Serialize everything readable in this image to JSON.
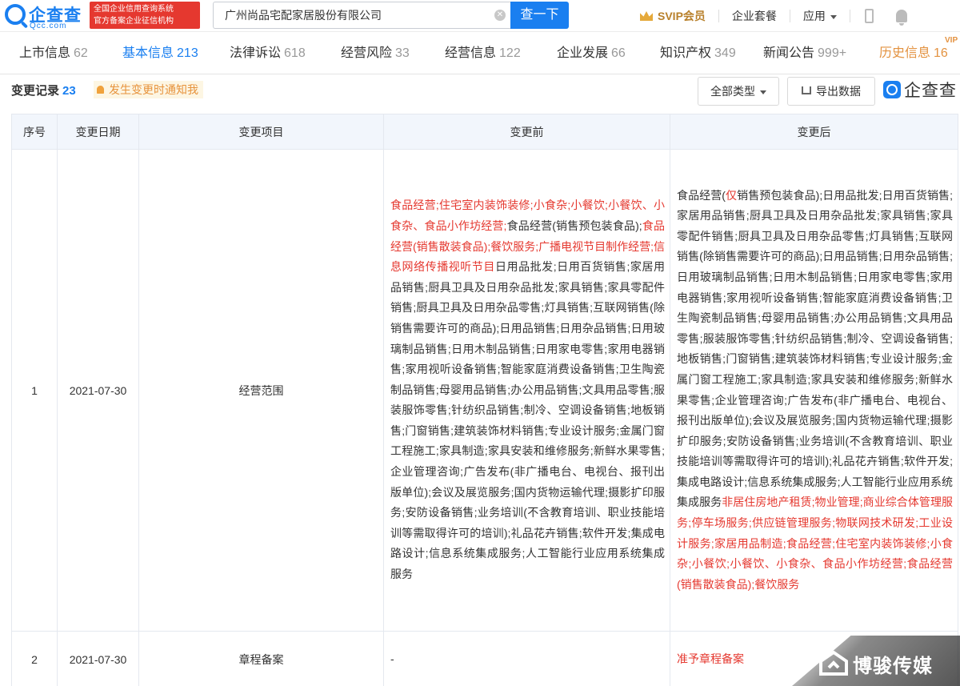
{
  "header": {
    "logo_text": "企查查",
    "logo_sub": "Qcc.com",
    "badge_line1": "全国企业信用查询系统",
    "badge_line2": "官方备案企业征信机构",
    "search_value": "广州尚品宅配家居股份有限公司",
    "search_button": "查一下",
    "svip": "SVIP会员",
    "enterprise_pkg": "企业套餐",
    "apps": "应用"
  },
  "tabs": [
    {
      "label": "上市信息",
      "count": "62"
    },
    {
      "label": "基本信息",
      "count": "213"
    },
    {
      "label": "法律诉讼",
      "count": "618"
    },
    {
      "label": "经营风险",
      "count": "33"
    },
    {
      "label": "经营信息",
      "count": "122"
    },
    {
      "label": "企业发展",
      "count": "66"
    },
    {
      "label": "知识产权",
      "count": "349"
    },
    {
      "label": "新闻公告",
      "count": "999+"
    },
    {
      "label": "历史信息",
      "count": "16"
    }
  ],
  "vip_tag": "VIP",
  "section": {
    "title": "变更记录",
    "count": "23",
    "notify": "发生变更时通知我",
    "type_filter": "全部类型",
    "export": "导出数据",
    "brand": "企查查"
  },
  "table": {
    "headers": [
      "序号",
      "变更日期",
      "变更项目",
      "变更前",
      "变更后"
    ],
    "rows": [
      {
        "index": "1",
        "date": "2021-07-30",
        "item": "经营范围",
        "before_red": "食品经营;住宅室内装饰装修;小食杂;小餐饮;小餐饮、小食杂、食品小作坊经营;",
        "before_mid1": "食品经营(销售预包装食品);",
        "before_red2": "食品经营(销售散装食品);餐饮服务;广播电视节目制作经营;信息网络传播视听节目",
        "before_rest": "日用品批发;日用百货销售;家居用品销售;厨具卫具及日用杂品批发;家具销售;家具零配件销售;厨具卫具及日用杂品零售;灯具销售;互联网销售(除销售需要许可的商品);日用品销售;日用杂品销售;日用玻璃制品销售;日用木制品销售;日用家电零售;家用电器销售;家用视听设备销售;智能家庭消费设备销售;卫生陶瓷制品销售;母婴用品销售;办公用品销售;文具用品零售;服装服饰零售;针纺织品销售;制冷、空调设备销售;地板销售;门窗销售;建筑装饰材料销售;专业设计服务;金属门窗工程施工;家具制造;家具安装和维修服务;新鲜水果零售;企业管理咨询;广告发布(非广播电台、电视台、报刊出版单位);会议及展览服务;国内货物运输代理;摄影扩印服务;安防设备销售;业务培训(不含教育培训、职业技能培训等需取得许可的培训);礼品花卉销售;软件开发;集成电路设计;信息系统集成服务;人工智能行业应用系统集成服务",
        "after_a": "食品经营(",
        "after_b": "仅",
        "after_c": "销售预包装食品);日用品批发;日用百货销售;家居用品销售;厨具卫具及日用杂品批发;家具销售;家具零配件销售;厨具卫具及日用杂品零售;灯具销售;互联网销售(除销售需要许可的商品);日用品销售;日用杂品销售;日用玻璃制品销售;日用木制品销售;日用家电零售;家用电器销售;家用视听设备销售;智能家庭消费设备销售;卫生陶瓷制品销售;母婴用品销售;办公用品销售;文具用品零售;服装服饰零售;针纺织品销售;制冷、空调设备销售;地板销售;门窗销售;建筑装饰材料销售;专业设计服务;金属门窗工程施工;家具制造;家具安装和维修服务;新鲜水果零售;企业管理咨询;广告发布(非广播电台、电视台、报刊出版单位);会议及展览服务;国内货物运输代理;摄影扩印服务;安防设备销售;业务培训(不含教育培训、职业技能培训等需取得许可的培训);礼品花卉销售;软件开发;集成电路设计;信息系统集成服务;人工智能行业应用系统集成服务",
        "after_red": "非居住房地产租赁;物业管理;商业综合体管理服务;停车场服务;供应链管理服务;物联网技术研发;工业设计服务;家居用品制造;食品经营;住宅室内装饰装修;小食杂;小餐饮;小餐饮、小食杂、食品小作坊经营;食品经营(销售散装食品);餐饮服务"
      },
      {
        "index": "2",
        "date": "2021-07-30",
        "item": "章程备案",
        "before": "-",
        "after": "准予章程备案"
      }
    ]
  },
  "watermark": "博骏传媒"
}
